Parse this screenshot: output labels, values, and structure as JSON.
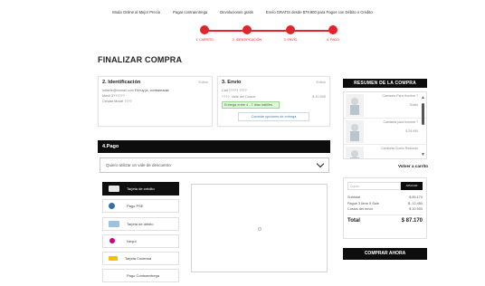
{
  "topbar": {
    "items": [
      "Moda Online al Mejor Precio",
      "Pagar contraentrega",
      "Devoluciones gratis",
      "Envío GRATIS desde $79.900 para Pagos con Débito o Crédito"
    ]
  },
  "steps": [
    "1. CARRITO",
    "2. IDENTIFICACIÓN",
    "3. ENVÍO",
    "4. PAGO"
  ],
  "colors": {
    "accent": "#e1252a",
    "dark": "#0d0d0d"
  },
  "page_title": "FINALIZAR COMPRA",
  "identification": {
    "title": "2. Identificación",
    "edit": "Editar",
    "email": "isthelle@homail.com",
    "name": "Eli tuy ja, contramadal",
    "phone": "Móvil 3??????",
    "address": "Celular Movel ????"
  },
  "shipping": {
    "title": "3. Envío",
    "edit": "Editar",
    "address": "Cali ????? ????",
    "city": "????, Valle del Cauca",
    "price": "$ 10.900",
    "delivery": "Entrega entre 4 - 7 días hábiles",
    "options_button": "Cambiar opciones de entrega"
  },
  "payment": {
    "bar_title": "4.Pago",
    "voucher": "Quiero utilizar un vale de descuento",
    "methods": [
      {
        "label": "Tarjeta de crédito",
        "icon": "credit-card-icon",
        "color": "#e8e8e8",
        "active": true
      },
      {
        "label": "Pago PSE",
        "icon": "pse-icon",
        "color": "#3a6ea5",
        "active": false
      },
      {
        "label": "Tarjeta de débito",
        "icon": "debit-card-icon",
        "color": "#9fc1dc",
        "active": false
      },
      {
        "label": "Nequi",
        "icon": "nequi-icon",
        "color": "#d2007d",
        "active": false
      },
      {
        "label": "Tarjeta Codensa",
        "icon": "codensa-icon",
        "color": "#f2c200",
        "active": false
      },
      {
        "label": "Pago Contraentrega",
        "icon": "",
        "color": "",
        "active": false
      }
    ]
  },
  "summary": {
    "title": "RESUMEN DE LA COMPRA",
    "products": [
      {
        "name": "Camiseta Para Hombre ?",
        "price": "Gratis"
      },
      {
        "name": "Camiseta para hombre ?",
        "price": "$ 29.990"
      },
      {
        "name": "Camiseta Cuello Redondo",
        "price": ""
      }
    ],
    "back_to_cart": "Volver a carrito",
    "coupon_placeholder": "Cupón",
    "coupon_apply": "APLICAR",
    "rows": [
      {
        "label": "Subtotal",
        "value": "$ 85.170"
      },
      {
        "label": "Pague 3 lleve 5 Sale",
        "value": "$ -12.450"
      },
      {
        "label": "Costos del envío",
        "value": "$ 10.900"
      }
    ],
    "total_label": "Total",
    "total_value": "$ 87.170",
    "buy_button": "COMPRAR AHORA"
  }
}
